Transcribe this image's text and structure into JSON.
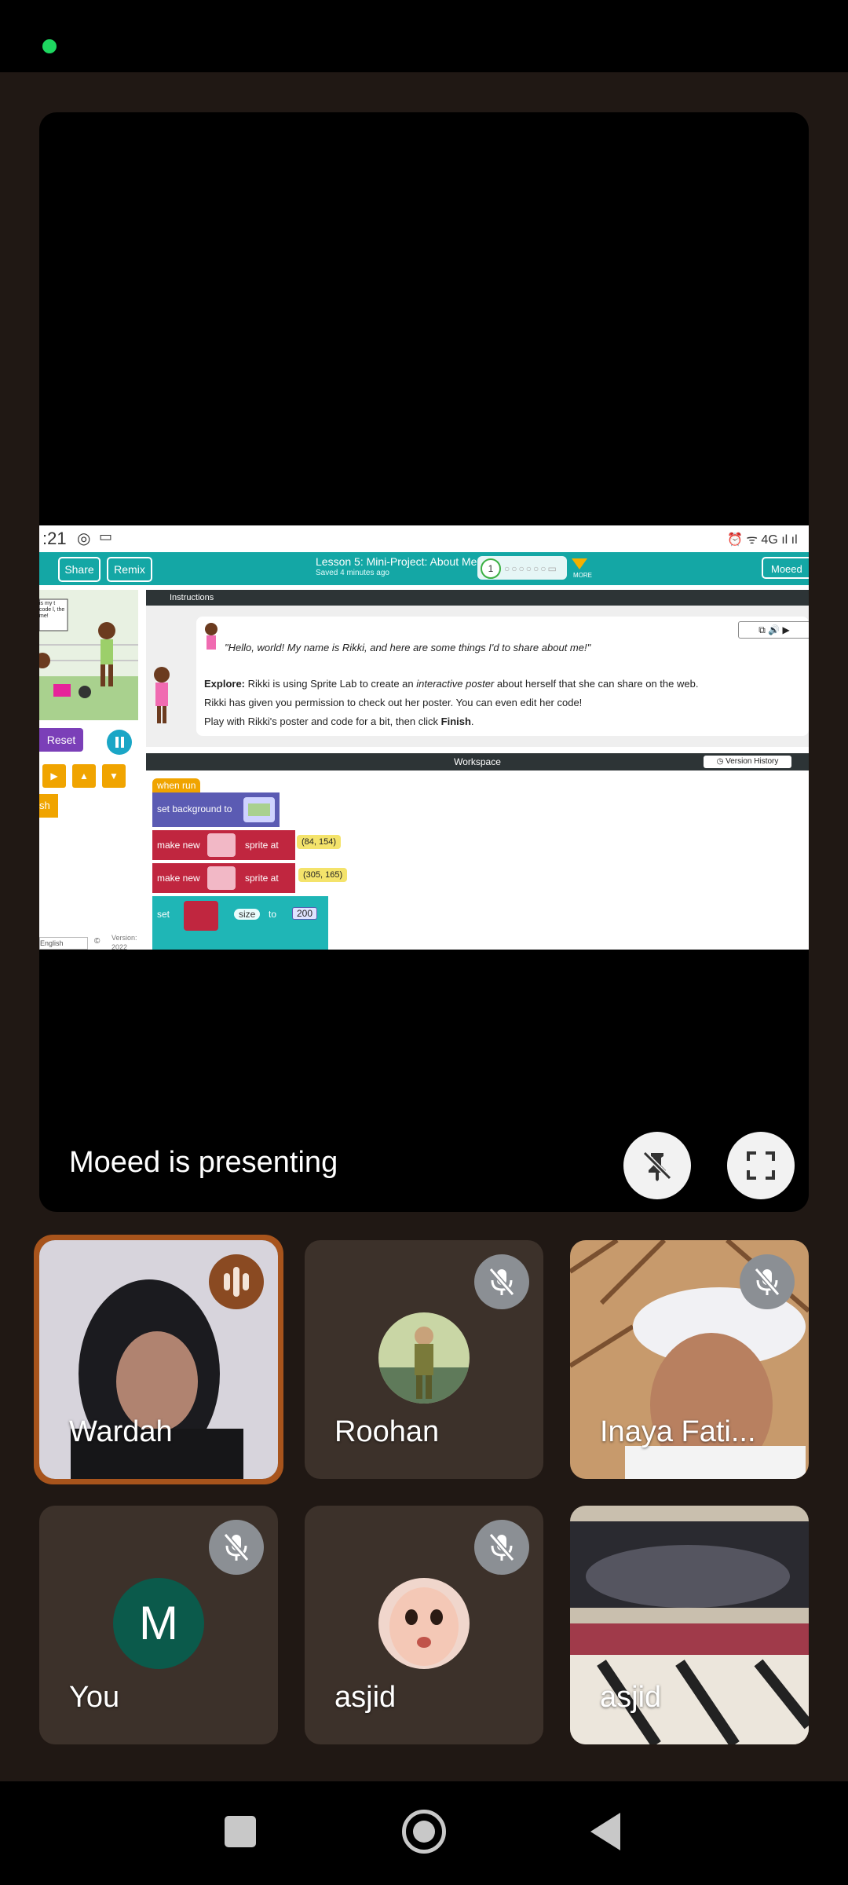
{
  "shared_screen": {
    "status_time": ":21",
    "lesson_title": "Lesson 5: Mini-Project: About Me",
    "saved_text": "Saved 4 minutes ago",
    "share_label": "Share",
    "remix_label": "Remix",
    "progress_current": "1",
    "more_label": "MORE",
    "user_menu": "Moeed",
    "instructions_tab": "Instructions",
    "quote": "\"Hello, world! My name is Rikki, and here are some things I'd to share about me!\"",
    "explore_bold": "Explore:",
    "explore_text_1": "Rikki is using Sprite Lab to create an",
    "explore_italic": "interactive poster",
    "explore_text_2": "about herself that she can share on the web.",
    "line2": "Rikki has given you permission to check out her poster. You can even edit her code!",
    "line3_prefix": "Play with Rikki's poster and code for a bit, then click",
    "line3_bold": "Finish",
    "line3_suffix": ".",
    "reset_label": "Reset",
    "finish_partial": "sh",
    "language": "English",
    "version_label": "Version:",
    "version_year": "2022",
    "workspace_label": "Workspace",
    "version_history": "Version History",
    "blocks": {
      "when_run": "when run",
      "set_background": "set background to",
      "make_new": "make new",
      "sprite_at": "sprite at",
      "coord1": "(84, 154)",
      "coord2": "(305, 165)",
      "set": "set",
      "size": "size",
      "to": "to",
      "size_value": "200"
    },
    "speech_note": "is my t code l, the me!"
  },
  "presenting": {
    "text": "Moeed is presenting"
  },
  "participants": [
    {
      "name": "Wardah",
      "speaking": true
    },
    {
      "name": "Roohan",
      "muted": true
    },
    {
      "name": "Inaya Fati...",
      "muted": true
    },
    {
      "name": "You",
      "initial": "M",
      "muted": true
    },
    {
      "name": "asjid",
      "muted": true
    },
    {
      "name": "asjid",
      "muted": false
    }
  ],
  "colors": {
    "background": "#201814",
    "tile": "#3c312a",
    "speaking_border": "#a8541c",
    "avatar_you": "#0b5a4b",
    "accent_teal": "#14a7a5"
  }
}
